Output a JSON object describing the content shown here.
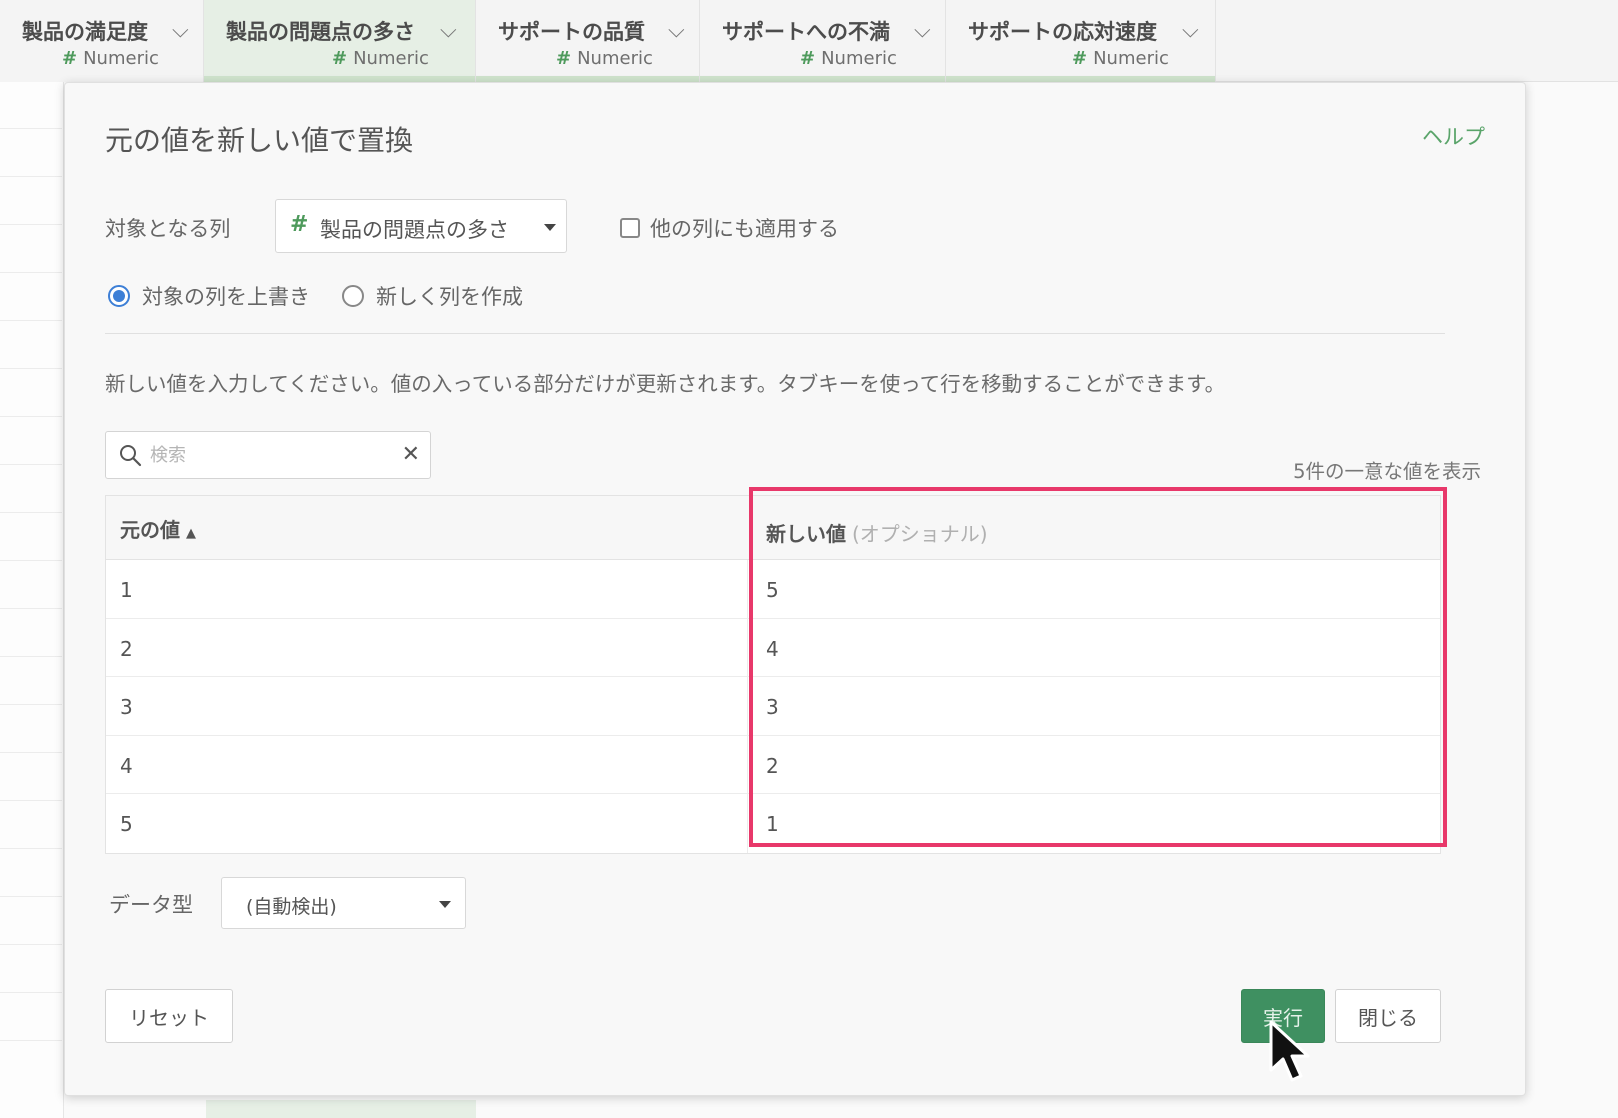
{
  "columns": [
    {
      "name": "製品の満足度",
      "type": "Numeric",
      "selected": false
    },
    {
      "name": "製品の問題点の多さ",
      "type": "Numeric",
      "selected": true
    },
    {
      "name": "サポートの品質",
      "type": "Numeric",
      "selected": false
    },
    {
      "name": "サポートへの不満",
      "type": "Numeric",
      "selected": false
    },
    {
      "name": "サポートの応対速度",
      "type": "Numeric",
      "selected": false
    }
  ],
  "dialog": {
    "title": "元の値を新しい値で置換",
    "help": "ヘルプ",
    "target_label": "対象となる列",
    "target_value": "製品の問題点の多さ",
    "apply_other": "他の列にも適用する",
    "radio_overwrite": "対象の列を上書き",
    "radio_new": "新しく列を作成",
    "instruction": "新しい値を入力してください。値の入っている部分だけが更新されます。タブキーを使って行を移動することができます。",
    "search_placeholder": "検索",
    "count_text": "5件の一意な値を表示",
    "header_original": "元の値",
    "header_new": "新しい値",
    "header_new_optional": "(オプショナル)",
    "rows": [
      {
        "original": "1",
        "new": "5"
      },
      {
        "original": "2",
        "new": "4"
      },
      {
        "original": "3",
        "new": "3"
      },
      {
        "original": "4",
        "new": "2"
      },
      {
        "original": "5",
        "new": "1"
      }
    ],
    "datatype_label": "データ型",
    "datatype_value": "(自動検出)",
    "reset": "リセット",
    "run": "実行",
    "close": "閉じる"
  },
  "colors": {
    "accent_green": "#3f9061",
    "highlight": "#e8386a",
    "radio_blue": "#3d7fd6"
  }
}
